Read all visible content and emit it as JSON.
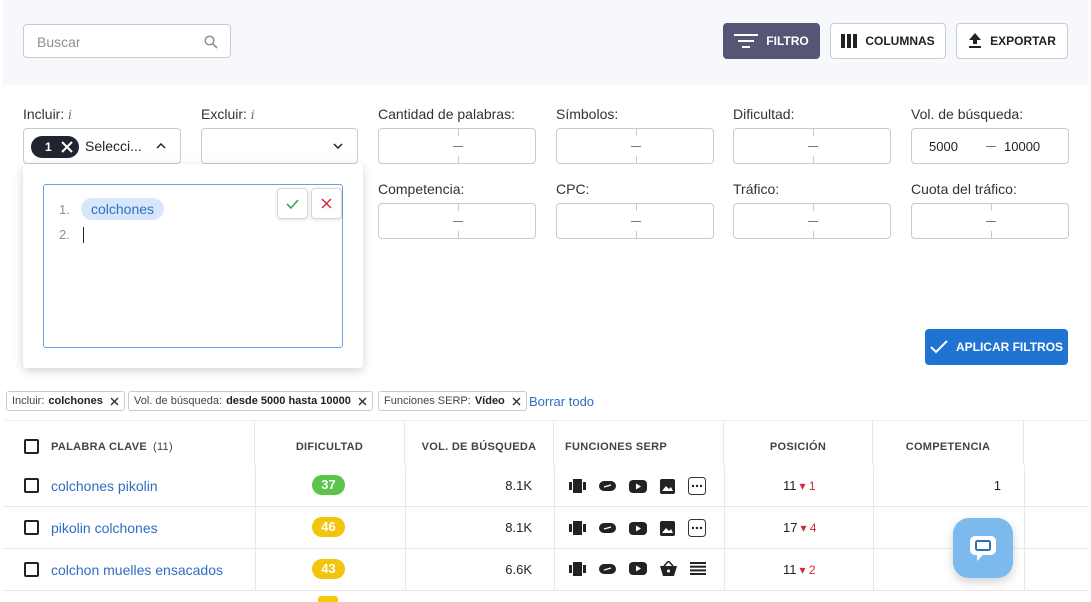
{
  "toolbar": {
    "search_placeholder": "Buscar",
    "filter_label": "FILTRO",
    "columns_label": "COLUMNAS",
    "export_label": "EXPORTAR"
  },
  "filters": {
    "include_label": "Incluir:",
    "include_info": "i",
    "include_count": "1",
    "include_select_text": "Selecci...",
    "exclude_label": "Excluir:",
    "exclude_info": "i",
    "word_count_label": "Cantidad de palabras:",
    "symbols_label": "Símbolos:",
    "difficulty_label": "Dificultad:",
    "search_volume_label": "Vol. de búsqueda:",
    "search_volume_from": "5000",
    "search_volume_to": "10000",
    "competition_label": "Competencia:",
    "cpc_label": "CPC:",
    "traffic_label": "Tráfico:",
    "traffic_share_label": "Cuota del tráfico:",
    "apply_label": "APLICAR FILTROS"
  },
  "include_editor": {
    "line1_number": "1.",
    "line1_value": "colchones",
    "line2_number": "2."
  },
  "active_filters": {
    "tag1_label": "Incluir:",
    "tag1_value": "colchones",
    "tag2_label": "Vol. de búsqueda:",
    "tag2_value": "desde 5000 hasta 10000",
    "tag3_label": "Funciones SERP:",
    "tag3_value": "Vídeo",
    "clear_all": "Borrar todo"
  },
  "table": {
    "headers": {
      "keyword": "PALABRA CLAVE",
      "keyword_count": "(11)",
      "difficulty": "DIFICULTAD",
      "volume": "VOL. DE BÚSQUEDA",
      "serp": "FUNCIONES SERP",
      "position": "POSICIÓN",
      "competition": "COMPETENCIA"
    },
    "rows": [
      {
        "keyword": "colchones pikolin",
        "difficulty": "37",
        "difficulty_color": "#5cc34b",
        "volume": "8.1K",
        "position": "11",
        "change": "1",
        "competition": "1"
      },
      {
        "keyword": "pikolin colchones",
        "difficulty": "46",
        "difficulty_color": "#f2c40c",
        "volume": "8.1K",
        "position": "17",
        "change": "4",
        "competition": ""
      },
      {
        "keyword": "colchon muelles ensacados",
        "difficulty": "43",
        "difficulty_color": "#f2c40c",
        "volume": "6.6K",
        "position": "11",
        "change": "2",
        "competition": ""
      }
    ]
  },
  "icons": {
    "search": "search-icon",
    "filter": "filter-icon",
    "columns": "columns-icon",
    "export": "upload-icon",
    "chat": "chat-icon"
  },
  "colors": {
    "accent": "#1e73d3",
    "filter_active": "#555575",
    "link": "#2e6ec2",
    "negative": "#d4293d"
  }
}
